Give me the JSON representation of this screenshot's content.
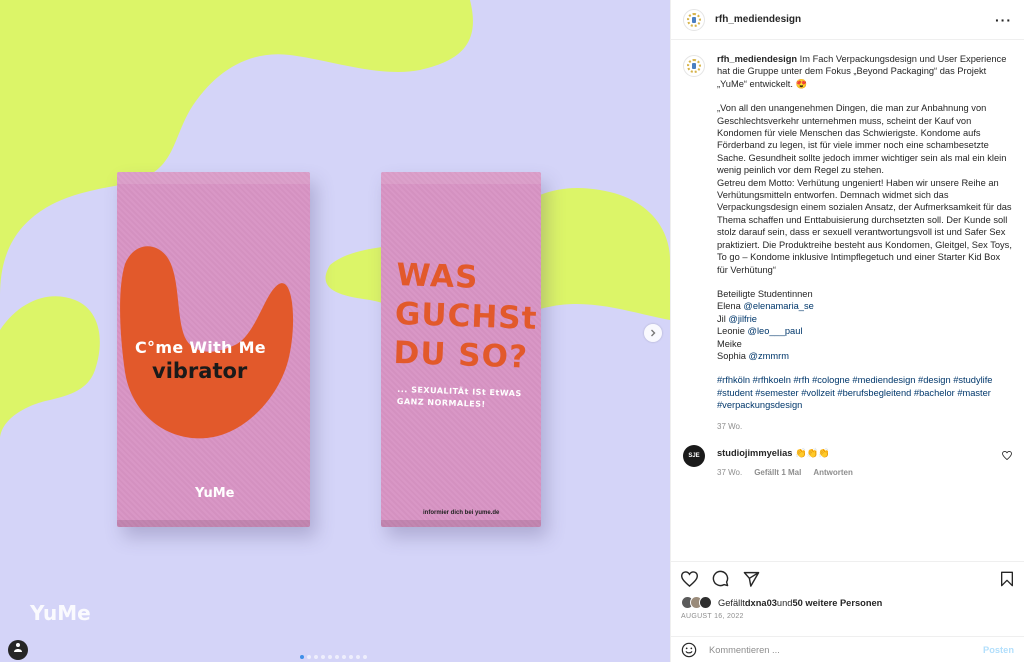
{
  "media": {
    "left_box": {
      "tagline": "C°me With Me",
      "product": "vibrator",
      "logo": "YuMe"
    },
    "right_box": {
      "headline": "WAS\nGUCHSt\nDU SO?",
      "subline": "... SEXUALITÄt ISt EtWAS\nGANZ NORMALES!",
      "footer": "informier dich bei yume.de"
    },
    "corner_logo": "YuMe",
    "slide_count": 10,
    "active_slide": 1,
    "colors": {
      "background": "#d4d4f8",
      "blob": "#dcf568",
      "box": "#d894c4",
      "accent": "#e2592b"
    }
  },
  "post": {
    "username": "rfh_mediendesign",
    "caption": {
      "username": "rfh_mediendesign",
      "intro": " Im Fach Verpackungsdesign und User Experience hat die Gruppe unter dem Fokus „Beyond Packaging“ das Projekt „YuMe“ entwickelt. 😍",
      "body": "„Von all den unangenehmen Dingen, die man zur Anbahnung von Geschlechtsverkehr unternehmen muss, scheint der Kauf von Kondomen für viele Menschen das Schwierigste. Kondome aufs Förderband zu legen, ist für viele immer noch eine schambesetzte Sache. Gesundheit sollte jedoch immer wichtiger sein als mal ein klein wenig peinlich vor dem Regel zu stehen.\nGetreu dem Motto: Verhütung ungeniert! Haben wir unsere Reihe an Verhütungsmitteln entworfen. Demnach widmet sich das Verpackungsdesign einem sozialen Ansatz, der Aufmerksamkeit für das Thema schaffen und Enttabuisierung durchsetzten soll. Der Kunde soll stolz darauf sein, dass er sexuell verantwortungsvoll ist und Safer Sex praktiziert. Die Produktreihe besteht aus Kondomen, Gleitgel, Sex Toys, To go – Kondome inklusive Intimpflegetuch und einer Starter Kid Box für Verhütung“",
      "students_heading": "Beteiligte Studentinnen",
      "students": [
        {
          "name": "Elena",
          "handle": "@elenamaria_se"
        },
        {
          "name": "Jil",
          "handle": "@jilfrie"
        },
        {
          "name": "Leonie",
          "handle": "@leo___paul"
        },
        {
          "name": "Meike",
          "handle": ""
        },
        {
          "name": "Sophia",
          "handle": "@zmmrm"
        }
      ],
      "hashtags": "#rfhköln #rfhkoeln #rfh #cologne #mediendesign #design #studylife #student #semester #vollzeit #berufsbegleitend #bachelor #master #verpackungsdesign",
      "time_ago": "37 Wo."
    },
    "comments": [
      {
        "avatar_text": "SJE",
        "username": "studiojimmyelias",
        "text": " 👏👏👏",
        "time_ago": "37 Wo.",
        "likes": "Gefällt 1 Mal",
        "reply": "Antworten"
      }
    ],
    "likes_prefix": "Gefällt ",
    "liked_by": "dxna03",
    "likes_middle": " und ",
    "likes_others": "50 weitere Personen",
    "date": "AUGUST 16, 2022",
    "comment_placeholder": "Kommentieren ...",
    "post_label": "Posten"
  }
}
